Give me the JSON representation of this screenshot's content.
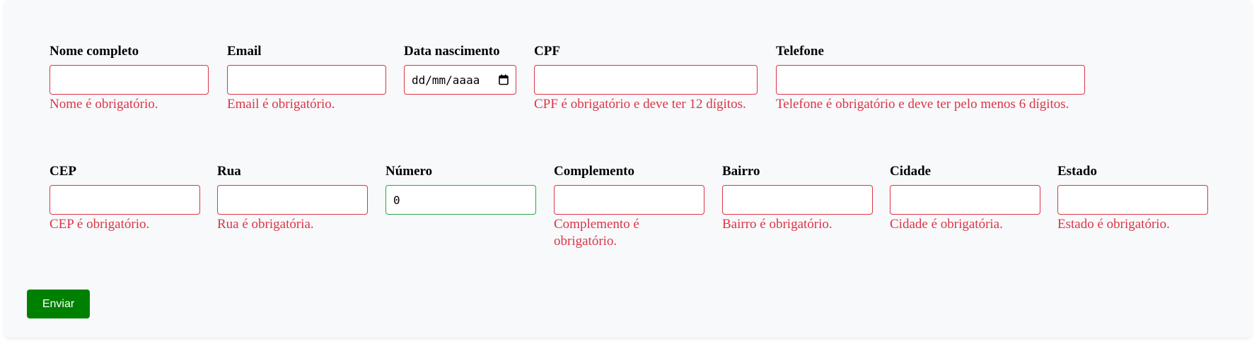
{
  "form": {
    "row1": [
      {
        "label": "Nome completo",
        "value": "",
        "error": "Nome é obrigatório."
      },
      {
        "label": "Email",
        "value": "",
        "error": "Email é obrigatório."
      },
      {
        "label": "Data nascimento",
        "placeholder": "dd/mm/aaaa",
        "error": ""
      },
      {
        "label": "CPF",
        "value": "",
        "error": "CPF é obrigatório e deve ter 12 dígitos."
      },
      {
        "label": "Telefone",
        "value": "",
        "error": "Telefone é obrigatório e deve ter pelo menos 6 dígitos."
      }
    ],
    "row2": [
      {
        "label": "CEP",
        "value": "",
        "error": "CEP é obrigatório."
      },
      {
        "label": "Rua",
        "value": "",
        "error": "Rua é obrigatória."
      },
      {
        "label": "Número",
        "value": "0",
        "error": ""
      },
      {
        "label": "Complemento",
        "value": "",
        "error": "Complemento é obrigatório."
      },
      {
        "label": "Bairro",
        "value": "",
        "error": "Bairro é obrigatório."
      },
      {
        "label": "Cidade",
        "value": "",
        "error": "Cidade é obrigatória."
      },
      {
        "label": "Estado",
        "value": "",
        "error": "Estado é obrigatório."
      }
    ],
    "submit_label": "Enviar"
  },
  "colors": {
    "error": "#dc3545",
    "valid": "#28a745",
    "submit": "#008000",
    "background": "#f8f9fb"
  },
  "icons": {
    "date": "calendar-icon"
  }
}
